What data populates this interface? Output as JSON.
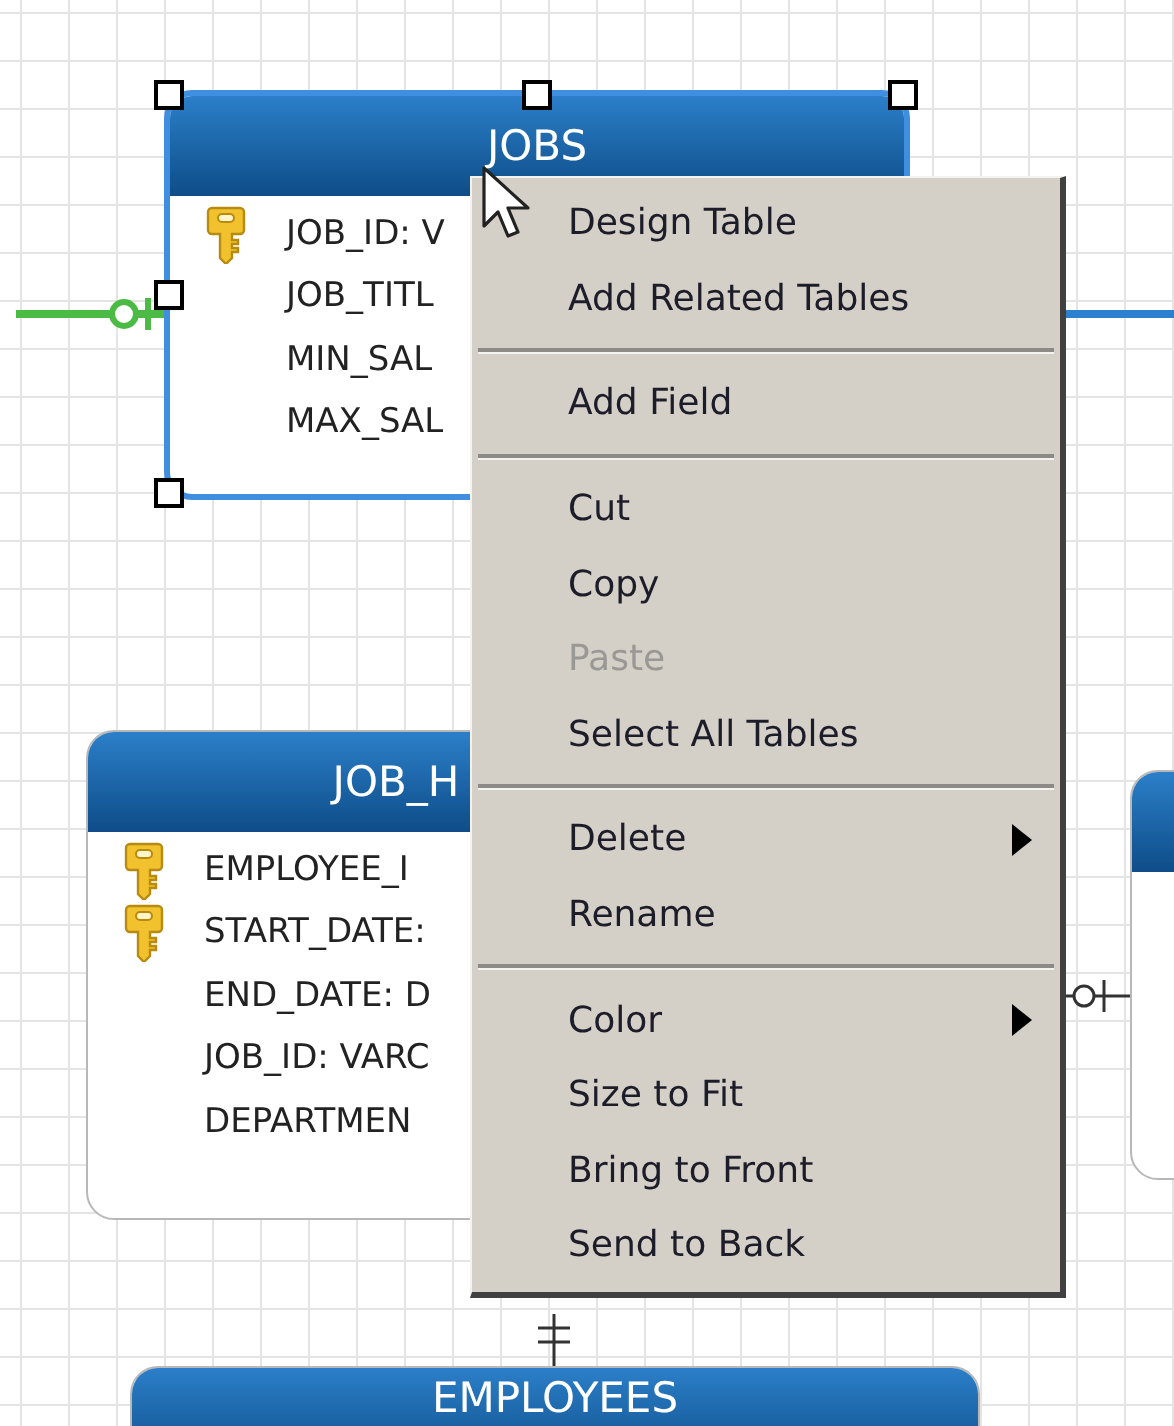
{
  "tables": [
    {
      "name": "JOBS",
      "selected": true,
      "columns": [
        {
          "text": "JOB_ID: V",
          "key": true
        },
        {
          "text": "JOB_TITL",
          "key": false
        },
        {
          "text": "MIN_SAL",
          "key": false
        },
        {
          "text": "MAX_SAL",
          "key": false
        }
      ]
    },
    {
      "name": "JOB_H",
      "selected": false,
      "columns": [
        {
          "text": "EMPLOYEE_I",
          "key": true
        },
        {
          "text": "START_DATE:",
          "key": true
        },
        {
          "text": "END_DATE: D",
          "key": false
        },
        {
          "text": "JOB_ID: VARC",
          "key": false
        },
        {
          "text": "DEPARTMEN",
          "key": false
        }
      ]
    },
    {
      "name": "EMPLOYEES",
      "selected": false
    }
  ],
  "context_menu": {
    "groups": [
      [
        {
          "label": "Design Table",
          "disabled": false,
          "submenu": false
        },
        {
          "label": "Add Related Tables",
          "disabled": false,
          "submenu": false
        }
      ],
      [
        {
          "label": "Add Field",
          "disabled": false,
          "submenu": false
        }
      ],
      [
        {
          "label": "Cut",
          "disabled": false,
          "submenu": false
        },
        {
          "label": "Copy",
          "disabled": false,
          "submenu": false
        },
        {
          "label": "Paste",
          "disabled": true,
          "submenu": false
        },
        {
          "label": "Select All Tables",
          "disabled": false,
          "submenu": false
        }
      ],
      [
        {
          "label": "Delete",
          "disabled": false,
          "submenu": true
        },
        {
          "label": "Rename",
          "disabled": false,
          "submenu": false
        }
      ],
      [
        {
          "label": "Color",
          "disabled": false,
          "submenu": true
        },
        {
          "label": "Size to Fit",
          "disabled": false,
          "submenu": false
        },
        {
          "label": "Bring to Front",
          "disabled": false,
          "submenu": false
        },
        {
          "label": "Send to Back",
          "disabled": false,
          "submenu": false
        }
      ]
    ]
  }
}
